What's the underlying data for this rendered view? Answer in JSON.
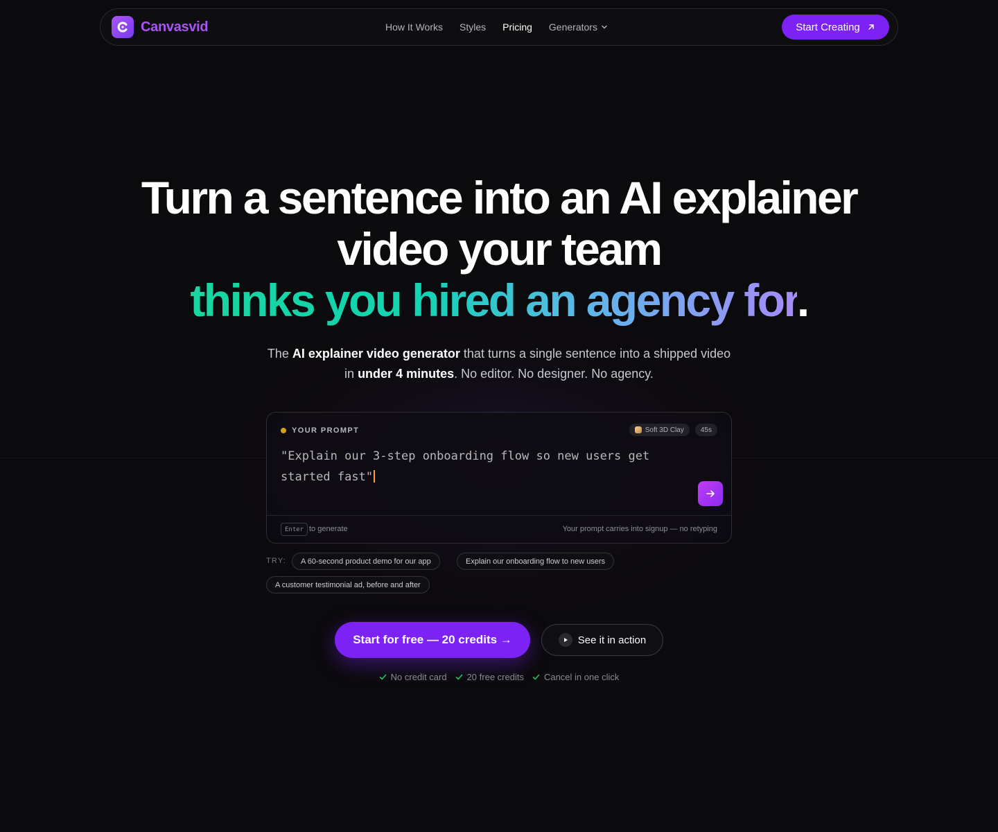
{
  "nav": {
    "brand": "Canvasvid",
    "links": [
      {
        "label": "How It Works"
      },
      {
        "label": "Styles"
      },
      {
        "label": "Pricing"
      },
      {
        "label": "Generators"
      }
    ],
    "cta": "Start Creating"
  },
  "hero": {
    "line1": "Turn a sentence into an AI explainer",
    "line2": "video your team",
    "line3": "thinks you hired an agency for",
    "line3_end": ".",
    "sub_pre": "The ",
    "sub_bold1": "AI explainer video generator",
    "sub_mid": " that turns a single sentence into a shipped video in ",
    "sub_bold2": "under 4 minutes",
    "sub_end": ". No editor. No designer. No agency."
  },
  "prompt_card": {
    "label": "YOUR PROMPT",
    "style_pill": "Soft 3D Clay",
    "duration_pill": "45s",
    "prompt_text": "\"Explain our 3-step onboarding flow so new users get started fast\"",
    "enter_key": "Enter",
    "enter_hint": "to generate",
    "carry_note": "Your prompt carries into signup — no retyping"
  },
  "suggestions": {
    "label": "TRY:",
    "chips": [
      "A 60-second product demo for our app",
      "Explain our onboarding flow to new users",
      "A customer testimonial ad, before and after"
    ]
  },
  "actions": {
    "primary": "Start for free — 20 credits →",
    "secondary": "See it in action"
  },
  "perks": [
    "No credit card",
    "20 free credits",
    "Cancel in one click"
  ],
  "colors": {
    "accent": "#7c22f5",
    "brand": "#a855f7",
    "gradient_start": "#19d6a0",
    "gradient_end": "#a78bfa",
    "check": "#22c55e"
  }
}
